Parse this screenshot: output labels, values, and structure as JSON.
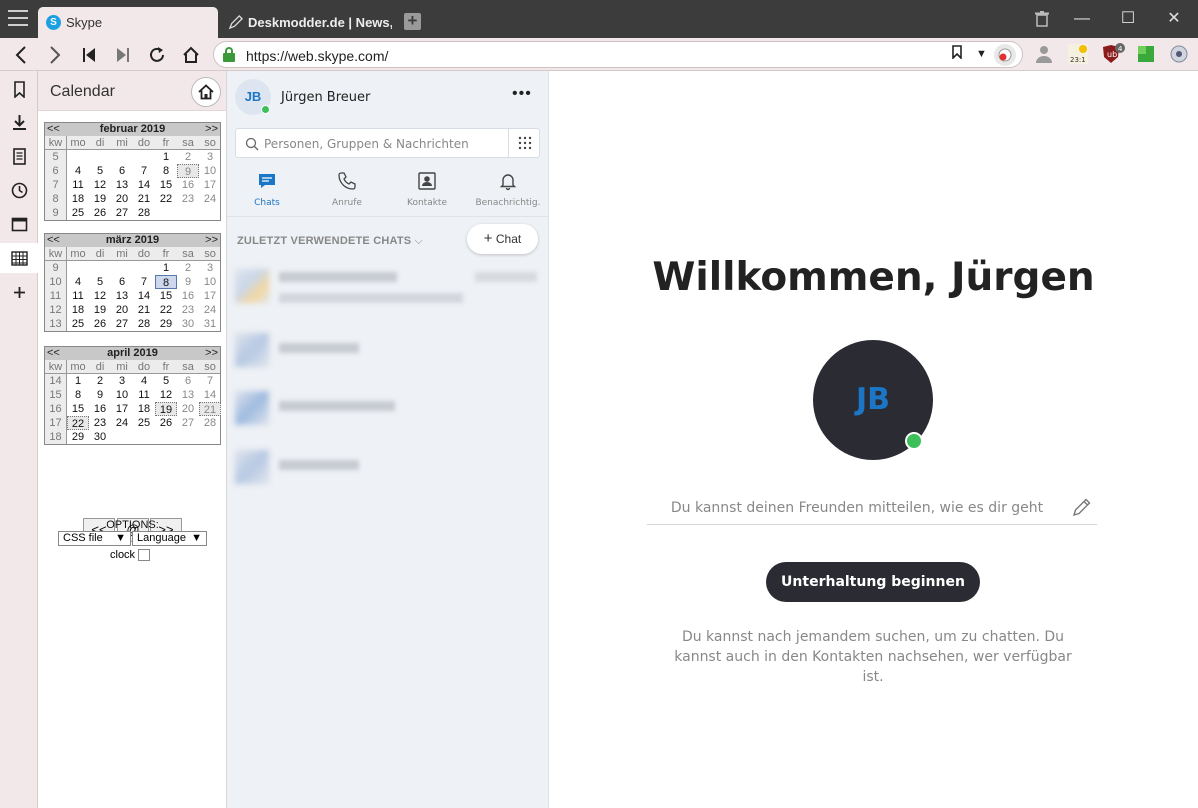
{
  "browser": {
    "tabs": [
      {
        "title": "Skype",
        "active": true
      },
      {
        "title": "Deskmodder.de | News, Tip",
        "active": false
      }
    ],
    "url": "https://web.skype.com/"
  },
  "calendar": {
    "title": "Calendar",
    "months": [
      {
        "title": "februar 2019",
        "weeks": [
          {
            "kw": "5",
            "days": [
              "",
              "",
              "",
              "",
              "1",
              "2",
              "3"
            ]
          },
          {
            "kw": "6",
            "days": [
              "4",
              "5",
              "6",
              "7",
              "8",
              "9",
              "10"
            ]
          },
          {
            "kw": "7",
            "days": [
              "11",
              "12",
              "13",
              "14",
              "15",
              "16",
              "17"
            ]
          },
          {
            "kw": "8",
            "days": [
              "18",
              "19",
              "20",
              "21",
              "22",
              "23",
              "24"
            ]
          },
          {
            "kw": "9",
            "days": [
              "25",
              "26",
              "27",
              "28",
              "",
              "",
              ""
            ]
          }
        ]
      },
      {
        "title": "märz 2019",
        "weeks": [
          {
            "kw": "9",
            "days": [
              "",
              "",
              "",
              "",
              "1",
              "2",
              "3"
            ]
          },
          {
            "kw": "10",
            "days": [
              "4",
              "5",
              "6",
              "7",
              "8",
              "9",
              "10"
            ]
          },
          {
            "kw": "11",
            "days": [
              "11",
              "12",
              "13",
              "14",
              "15",
              "16",
              "17"
            ]
          },
          {
            "kw": "12",
            "days": [
              "18",
              "19",
              "20",
              "21",
              "22",
              "23",
              "24"
            ]
          },
          {
            "kw": "13",
            "days": [
              "25",
              "26",
              "27",
              "28",
              "29",
              "30",
              "31"
            ]
          }
        ]
      },
      {
        "title": "april 2019",
        "weeks": [
          {
            "kw": "14",
            "days": [
              "1",
              "2",
              "3",
              "4",
              "5",
              "6",
              "7"
            ]
          },
          {
            "kw": "15",
            "days": [
              "8",
              "9",
              "10",
              "11",
              "12",
              "13",
              "14"
            ]
          },
          {
            "kw": "16",
            "days": [
              "15",
              "16",
              "17",
              "18",
              "19",
              "20",
              "21"
            ]
          },
          {
            "kw": "17",
            "days": [
              "22",
              "23",
              "24",
              "25",
              "26",
              "27",
              "28"
            ]
          },
          {
            "kw": "18",
            "days": [
              "29",
              "30",
              "",
              "",
              "",
              "",
              ""
            ]
          }
        ]
      }
    ],
    "day_names": [
      "kw",
      "mo",
      "di",
      "mi",
      "do",
      "fr",
      "sa",
      "so"
    ],
    "nav_prev": "<<",
    "nav_next": ">>",
    "nav_today": "@",
    "options_label": "OPTIONS:",
    "css_select": "CSS file",
    "lang_select": "Language",
    "clock_label": "clock"
  },
  "skype": {
    "user_initials": "JB",
    "user_name": "Jürgen  Breuer",
    "search_placeholder": "Personen, Gruppen & Nachrichten",
    "tabs": [
      {
        "label": "Chats",
        "icon": "chat-icon"
      },
      {
        "label": "Anrufe",
        "icon": "phone-icon"
      },
      {
        "label": "Kontakte",
        "icon": "contacts-icon"
      },
      {
        "label": "Benachrichtig.",
        "icon": "bell-icon"
      }
    ],
    "recent_label": "ZULETZT VERWENDETE CHATS",
    "new_chat_label": "Chat",
    "welcome": "Willkommen, Jürgen",
    "mood_placeholder": "Du kannst deinen Freunden mitteilen, wie es dir geht",
    "start_button": "Unterhaltung beginnen",
    "hint": "Du kannst nach jemandem suchen, um zu chatten. Du kannst auch in den Kontakten nachsehen, wer verfügbar ist.",
    "accent_color": "#1b76c6",
    "presence_color": "#3dc05a"
  }
}
